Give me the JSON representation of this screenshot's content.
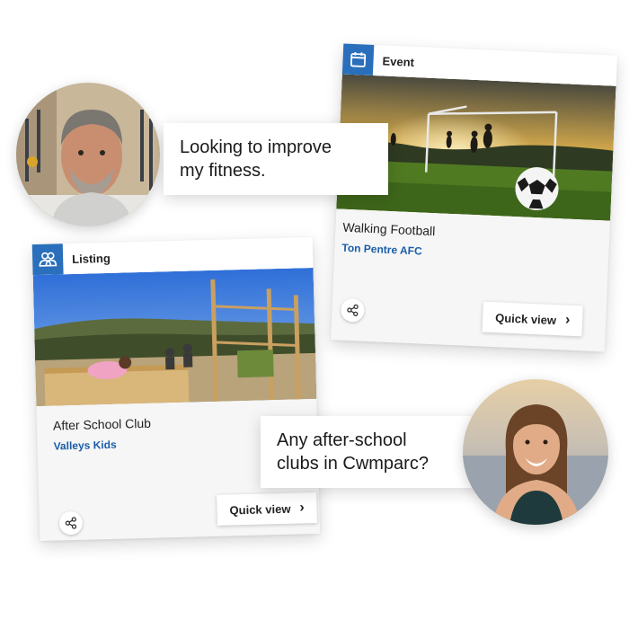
{
  "event_card": {
    "type_label": "Event",
    "type_icon": "calendar-icon",
    "title": "Walking Football",
    "organisation": "Ton Pentre AFC",
    "quick_view_label": "Quick view",
    "share_icon": "share-icon"
  },
  "listing_card": {
    "type_label": "Listing",
    "type_icon": "people-icon",
    "title": "After School Club",
    "organisation": "Valleys Kids",
    "quick_view_label": "Quick view",
    "share_icon": "share-icon"
  },
  "bubbles": {
    "man_line1": "Looking to improve",
    "man_line2": "my fitness.",
    "woman_line1": "Any after-school",
    "woman_line2": "clubs in Cwmparc?"
  },
  "colors": {
    "accent_blue": "#2a6fbb",
    "org_link": "#1b5ea8"
  }
}
